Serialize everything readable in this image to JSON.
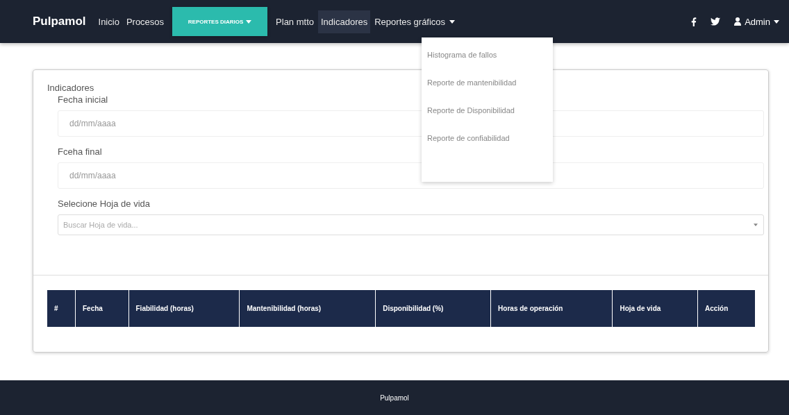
{
  "navbar": {
    "brand": "Pulpamol",
    "links": [
      {
        "label": "Inicio",
        "kind": "link",
        "selected": false
      },
      {
        "label": "Procesos",
        "kind": "link",
        "selected": false
      },
      {
        "label": "REPORTES DIARIOS",
        "kind": "dropdown-button",
        "selected": false
      },
      {
        "label": "Plan mtto",
        "kind": "link",
        "selected": false
      },
      {
        "label": "Indicadores",
        "kind": "link",
        "selected": true
      },
      {
        "label": "Reportes gráficos",
        "kind": "dropdown",
        "selected": false
      }
    ],
    "user": "Admin"
  },
  "dropdown_menu": {
    "items": [
      "Histograma de fallos",
      "Reporte de mantenibilidad",
      "Reporte de Disponibilidad",
      "Reporte de confiabilidad"
    ]
  },
  "card": {
    "title": "Indicadores",
    "fields": [
      {
        "label": "Fecha inicial",
        "kind": "date",
        "placeholder": "dd/mm/aaaa"
      },
      {
        "label": "Fceha final",
        "kind": "date",
        "placeholder": "dd/mm/aaaa"
      },
      {
        "label": "Selecione Hoja de vida",
        "kind": "select",
        "placeholder": "Buscar Hoja de vida..."
      }
    ]
  },
  "table": {
    "columns": [
      "#",
      "Fecha",
      "Fiabilidad (horas)",
      "Mantenibilidad (horas)",
      "Disponibilidad (%)",
      "Horas de operación",
      "Hoja de vida",
      "Acción"
    ]
  },
  "footer": {
    "text": "Pulpamol"
  }
}
